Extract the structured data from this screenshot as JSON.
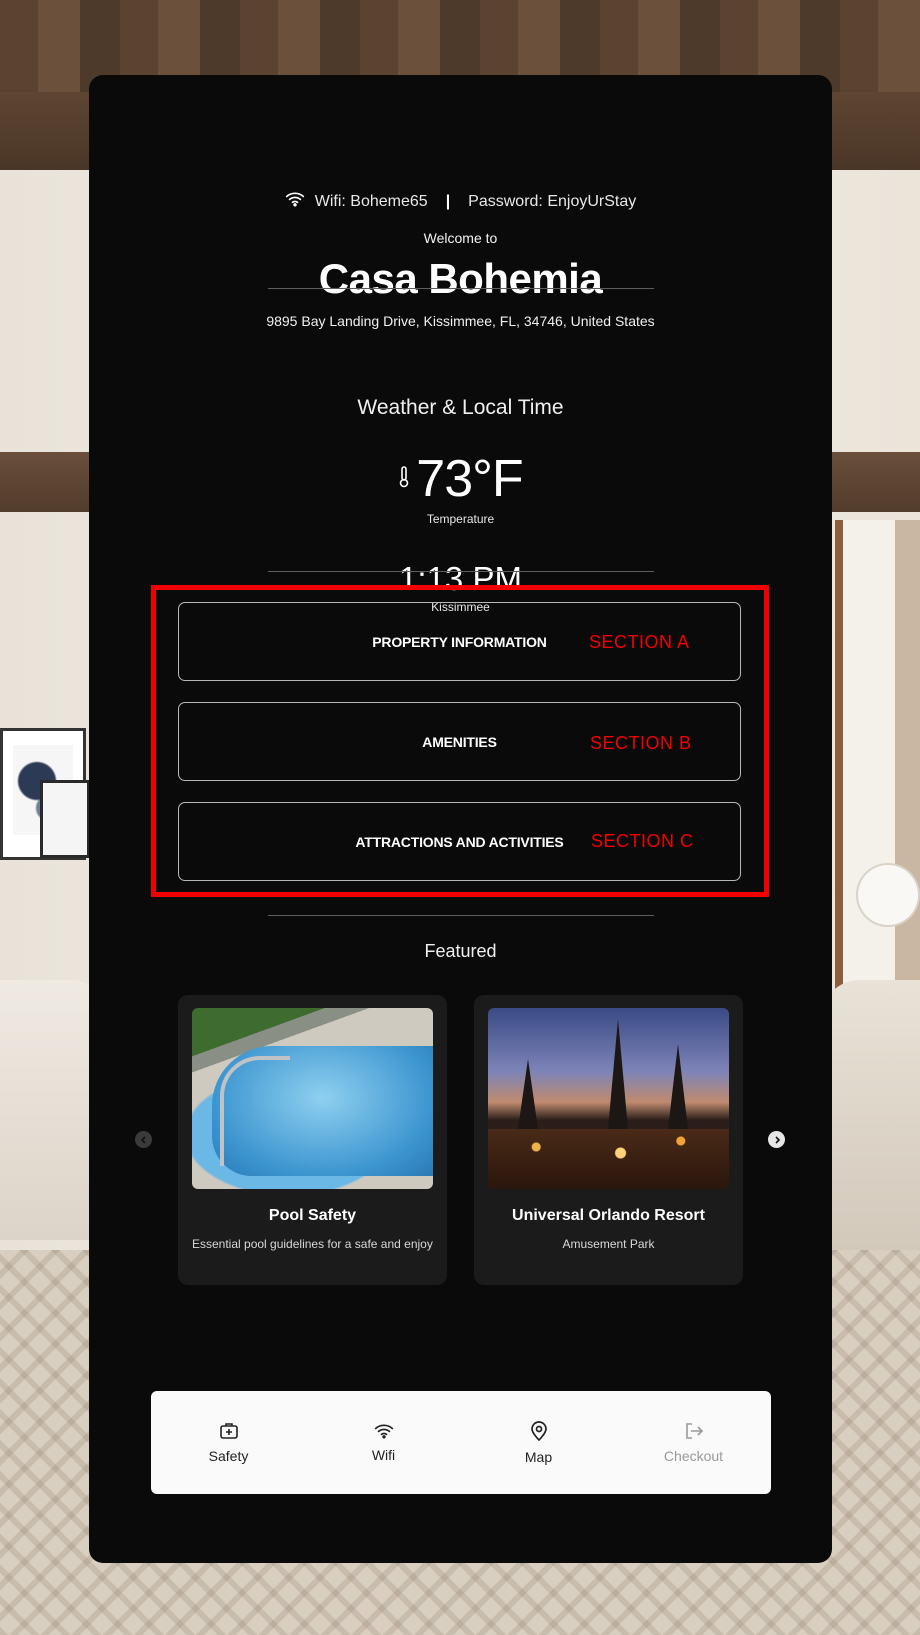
{
  "header": {
    "wifi_icon": "wifi-icon",
    "wifi_text": "Wifi: Boheme65",
    "separator": "|",
    "password_text": "Password: EnjoyUrStay",
    "welcome": "Welcome to",
    "title": "Casa Bohemia",
    "address": "9895 Bay Landing Drive, Kissimmee, FL, 34746, United States"
  },
  "weather": {
    "heading": "Weather & Local Time",
    "thermometer_icon": "thermometer-icon",
    "temperature": "73°F",
    "temperature_label": "Temperature",
    "time": "1:13 PM",
    "location": "Kissimmee"
  },
  "sections": [
    {
      "label": "PROPERTY INFORMATION",
      "tag": "SECTION A"
    },
    {
      "label": "AMENITIES",
      "tag": "SECTION B"
    },
    {
      "label": "ATTRACTIONS AND ACTIVITIES",
      "tag": "SECTION C"
    }
  ],
  "featured": {
    "heading": "Featured",
    "cards": [
      {
        "title": "Pool Safety",
        "subtitle": "Essential pool guidelines for a safe and enjoyable stay"
      },
      {
        "title": "Universal Orlando Resort",
        "subtitle": "Amusement Park"
      }
    ],
    "prev_icon": "chevron-left-icon",
    "next_icon": "chevron-right-icon"
  },
  "bottom_nav": [
    {
      "label": "Safety",
      "icon": "first-aid-kit-icon"
    },
    {
      "label": "Wifi",
      "icon": "wifi-icon"
    },
    {
      "label": "Map",
      "icon": "map-pin-icon"
    },
    {
      "label": "Checkout",
      "icon": "logout-icon"
    }
  ],
  "colors": {
    "panel_bg": "#0a0a0b",
    "highlight_red": "#f20000",
    "nav_bg": "#fafafa",
    "card_bg": "#1b1b1c"
  }
}
